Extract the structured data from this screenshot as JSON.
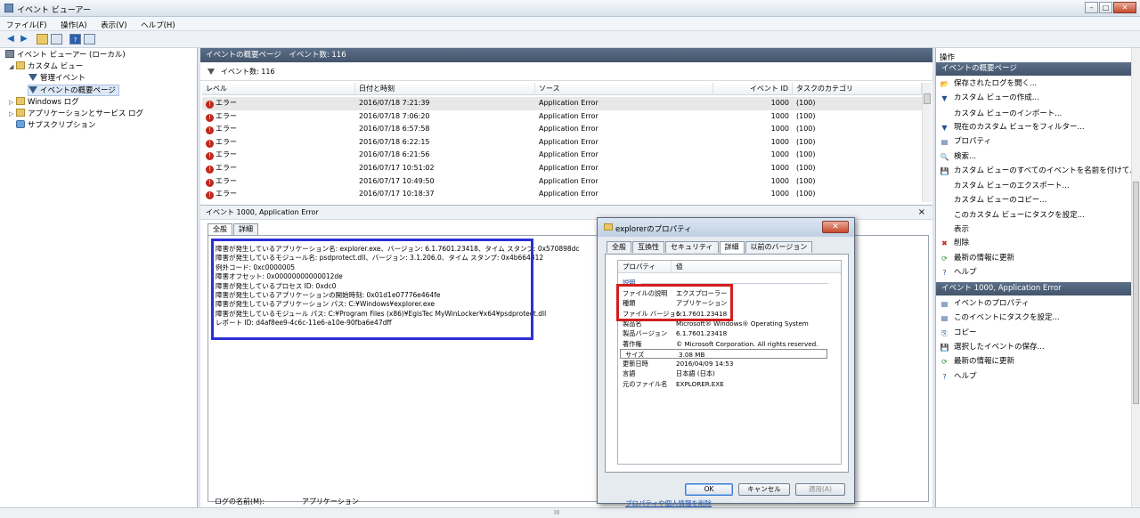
{
  "window": {
    "title": "イベント ビューアー"
  },
  "menu": [
    "ファイル(F)",
    "操作(A)",
    "表示(V)",
    "ヘルプ(H)"
  ],
  "tree": {
    "root": "イベント ビューアー (ローカル)",
    "custom_views": "カスタム ビュー",
    "admin_events": "管理イベント",
    "summary_page": "イベントの概要ページ",
    "windows_logs": "Windows ログ",
    "app_service_logs": "アプリケーションとサービス ログ",
    "subscriptions": "サブスクリプション"
  },
  "middle": {
    "header": "イベントの概要ページ　イベント数: 116",
    "count": "イベント数: 116",
    "columns": [
      "レベル",
      "日付と時刻",
      "ソース",
      "イベント ID",
      "タスクのカテゴリ"
    ],
    "rows": [
      {
        "level": "エラー",
        "date": "2016/07/18 7:21:39",
        "source": "Application Error",
        "id": "1000",
        "task": "(100)"
      },
      {
        "level": "エラー",
        "date": "2016/07/18 7:06:20",
        "source": "Application Error",
        "id": "1000",
        "task": "(100)"
      },
      {
        "level": "エラー",
        "date": "2016/07/18 6:57:58",
        "source": "Application Error",
        "id": "1000",
        "task": "(100)"
      },
      {
        "level": "エラー",
        "date": "2016/07/18 6:22:15",
        "source": "Application Error",
        "id": "1000",
        "task": "(100)"
      },
      {
        "level": "エラー",
        "date": "2016/07/18 6:21:56",
        "source": "Application Error",
        "id": "1000",
        "task": "(100)"
      },
      {
        "level": "エラー",
        "date": "2016/07/17 10:51:02",
        "source": "Application Error",
        "id": "1000",
        "task": "(100)"
      },
      {
        "level": "エラー",
        "date": "2016/07/17 10:49:50",
        "source": "Application Error",
        "id": "1000",
        "task": "(100)"
      },
      {
        "level": "エラー",
        "date": "2016/07/17 10:18:37",
        "source": "Application Error",
        "id": "1000",
        "task": "(100)"
      }
    ],
    "detail_title": "イベント 1000, Application Error",
    "detail_close": "×",
    "tabs": [
      "全般",
      "詳細"
    ],
    "description": "障害が発生しているアプリケーション名: explorer.exe、バージョン: 6.1.7601.23418、タイム スタンプ: 0x570898dc\n障害が発生しているモジュール名: psdprotect.dll、バージョン: 3.1.206.0、タイム スタンプ: 0x4b664312\n例外コード: 0xc0000005\n障害オフセット: 0x00000000000012de\n障害が発生しているプロセス ID: 0xdc0\n障害が発生しているアプリケーションの開始時刻: 0x01d1e07776e464fe\n障害が発生しているアプリケーション パス: C:¥Windows¥explorer.exe\n障害が発生しているモジュール パス: C:¥Program Files (x86)¥EgisTec MyWinLocker¥x64¥psdprotect.dll\nレポート ID: d4af8ee9-4c6c-11e6-a10e-90fba6e47dff",
    "log_name_label": "ログの名前(M):",
    "log_name_value": "アプリケーション"
  },
  "actions": {
    "title": "操作",
    "section1": "イベントの概要ページ",
    "items1": [
      "保存されたログを開く...",
      "カスタム ビューの作成...",
      "カスタム ビューのインポート...",
      "現在のカスタム ビューをフィルター...",
      "プロパティ",
      "検索...",
      "カスタム ビューのすべてのイベントを名前を付けて...",
      "カスタム ビューのエクスポート...",
      "カスタム ビューのコピー...",
      "このカスタム ビューにタスクを設定...",
      "表示",
      "削除",
      "最新の情報に更新",
      "ヘルプ"
    ],
    "section2": "イベント 1000, Application Error",
    "items2": [
      "イベントのプロパティ",
      "このイベントにタスクを設定...",
      "コピー",
      "選択したイベントの保存...",
      "最新の情報に更新",
      "ヘルプ"
    ]
  },
  "dialog": {
    "title": "explorerのプロパティ",
    "tabs": [
      "全般",
      "互換性",
      "セキュリティ",
      "詳細",
      "以前のバージョン"
    ],
    "col_property": "プロパティ",
    "col_value": "値",
    "section": "説明",
    "props": [
      {
        "k": "ファイルの説明",
        "v": "エクスプローラー"
      },
      {
        "k": "種類",
        "v": "アプリケーション"
      },
      {
        "k": "ファイル バージョン",
        "v": "6.1.7601.23418"
      },
      {
        "k": "製品名",
        "v": "Microsoft® Windows® Operating System"
      },
      {
        "k": "製品バージョン",
        "v": "6.1.7601.23418"
      },
      {
        "k": "著作権",
        "v": "© Microsoft Corporation. All rights reserved."
      },
      {
        "k": "サイズ",
        "v": "3.08 MB"
      },
      {
        "k": "更新日時",
        "v": "2016/04/09 14:53"
      },
      {
        "k": "言語",
        "v": "日本語 (日本)"
      },
      {
        "k": "元のファイル名",
        "v": "EXPLORER.EXE"
      }
    ],
    "link": "プロパティや個人情報を削除",
    "ok": "OK",
    "cancel": "キャンセル",
    "apply": "適用(A)"
  }
}
